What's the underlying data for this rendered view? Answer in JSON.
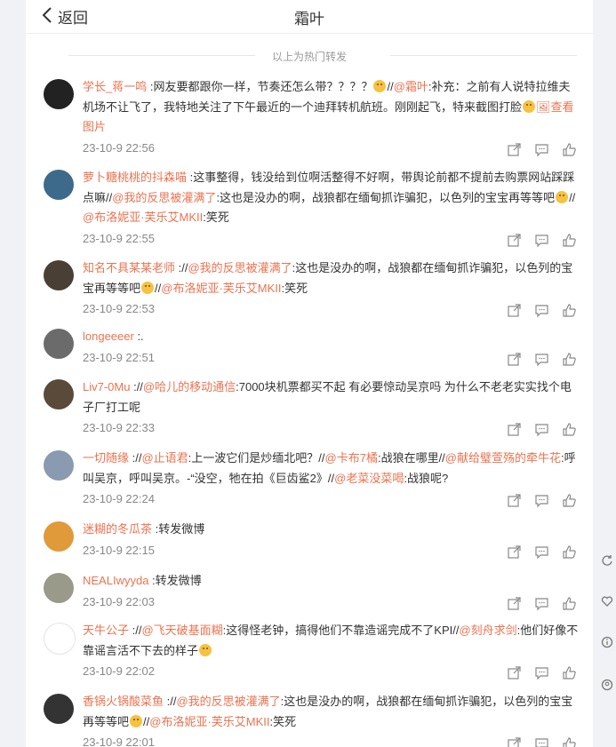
{
  "header": {
    "back_label": "返回",
    "title": "霜叶"
  },
  "note": "以上为热门转发",
  "comments": [
    {
      "user": "学长_蒋一鸣",
      "segments": [
        {
          "t": "text",
          "v": " :网友要都跟你一样，节奏还怎么带？？？？"
        },
        {
          "t": "emoji"
        },
        {
          "t": "text",
          "v": "//"
        },
        {
          "t": "mention",
          "v": "@霜叶"
        },
        {
          "t": "text",
          "v": ":补充：之前有人说特拉维夫机场不让飞了，我特地关注了下午最近的一个迪拜转机航班。刚刚起飞，特来截图打脸"
        },
        {
          "t": "emoji"
        },
        {
          "t": "pic",
          "v": "🖼查看图片"
        }
      ],
      "time": "23-10-9 22:56",
      "avatar": "#222"
    },
    {
      "user": "萝卜糖桃桃的抖森喵",
      "segments": [
        {
          "t": "text",
          "v": " :这事整得，钱没给到位啊活整得不好啊，带舆论前都不提前去购票网站踩踩点嘛//"
        },
        {
          "t": "mention",
          "v": "@我的反思被灌满了"
        },
        {
          "t": "text",
          "v": ":这也是没办的啊，战狼都在缅甸抓诈骗犯，以色列的宝宝再等等吧"
        },
        {
          "t": "emoji"
        },
        {
          "t": "text",
          "v": "//"
        },
        {
          "t": "mention",
          "v": "@布洛妮亚·芙乐艾MKII"
        },
        {
          "t": "text",
          "v": ":笑死"
        }
      ],
      "time": "23-10-9 22:55",
      "avatar": "#3d6a8a"
    },
    {
      "user": "知名不具某某老师",
      "segments": [
        {
          "t": "text",
          "v": " ://"
        },
        {
          "t": "mention",
          "v": "@我的反思被灌满了"
        },
        {
          "t": "text",
          "v": ":这也是没办的啊，战狼都在缅甸抓诈骗犯，以色列的宝宝再等等吧"
        },
        {
          "t": "emoji"
        },
        {
          "t": "text",
          "v": "//"
        },
        {
          "t": "mention",
          "v": "@布洛妮亚·芙乐艾MKII"
        },
        {
          "t": "text",
          "v": ":笑死"
        }
      ],
      "time": "23-10-9 22:53",
      "avatar": "#4a3f35"
    },
    {
      "user": "longeeeer",
      "segments": [
        {
          "t": "text",
          "v": " :."
        }
      ],
      "time": "23-10-9 22:51",
      "avatar": "#6b6b6b"
    },
    {
      "user": "Liv7-0Mu",
      "segments": [
        {
          "t": "text",
          "v": " ://"
        },
        {
          "t": "mention",
          "v": "@哈儿的移动通信"
        },
        {
          "t": "text",
          "v": ":7000块机票都买不起 有必要惊动吴京吗 为什么不老老实实找个电子厂打工呢"
        }
      ],
      "time": "23-10-9 22:33",
      "avatar": "#5a4a3a"
    },
    {
      "user": "一切随缘",
      "segments": [
        {
          "t": "text",
          "v": " ://"
        },
        {
          "t": "mention",
          "v": "@止语君"
        },
        {
          "t": "text",
          "v": ":上一波它们是炒缅北吧？//"
        },
        {
          "t": "mention",
          "v": "@卡布7橘"
        },
        {
          "t": "text",
          "v": ":战狼在哪里//"
        },
        {
          "t": "mention",
          "v": "@献给璧萱殇的牵牛花"
        },
        {
          "t": "text",
          "v": ":呼叫吴京，呼叫吴京。-“没空，牠在拍《巨齿鲨2》//"
        },
        {
          "t": "mention",
          "v": "@老菜没菜喝"
        },
        {
          "t": "text",
          "v": ":战狼呢?"
        }
      ],
      "time": "23-10-9 22:24",
      "avatar": "#8a9ab0"
    },
    {
      "user": "迷糊的冬瓜茶",
      "segments": [
        {
          "t": "text",
          "v": " :转发微博"
        }
      ],
      "time": "23-10-9 22:15",
      "avatar": "#e09a3a"
    },
    {
      "user": "NEALIwyyda",
      "segments": [
        {
          "t": "text",
          "v": " :转发微博"
        }
      ],
      "time": "23-10-9 22:03",
      "avatar": "#9a9a8a"
    },
    {
      "user": "天牛公子",
      "segments": [
        {
          "t": "text",
          "v": " ://"
        },
        {
          "t": "mention",
          "v": "@飞天破基面糊"
        },
        {
          "t": "text",
          "v": ":这得怪老钟，搞得他们不靠造谣完成不了KPI//"
        },
        {
          "t": "mention",
          "v": "@刻舟求剑"
        },
        {
          "t": "text",
          "v": ":他们好像不靠谣言活不下去的样子"
        },
        {
          "t": "emoji"
        }
      ],
      "time": "23-10-9 22:02",
      "avatar": "#ffffff"
    },
    {
      "user": "香锅火锅酸菜鱼",
      "segments": [
        {
          "t": "text",
          "v": " ://"
        },
        {
          "t": "mention",
          "v": "@我的反思被灌满了"
        },
        {
          "t": "text",
          "v": ":这也是没办的啊，战狼都在缅甸抓诈骗犯，以色列的宝宝再等等吧"
        },
        {
          "t": "emoji"
        },
        {
          "t": "text",
          "v": "//"
        },
        {
          "t": "mention",
          "v": "@布洛妮亚·芙乐艾MKII"
        },
        {
          "t": "text",
          "v": ":笑死"
        }
      ],
      "time": "23-10-9 22:01",
      "avatar": "#333333"
    }
  ]
}
